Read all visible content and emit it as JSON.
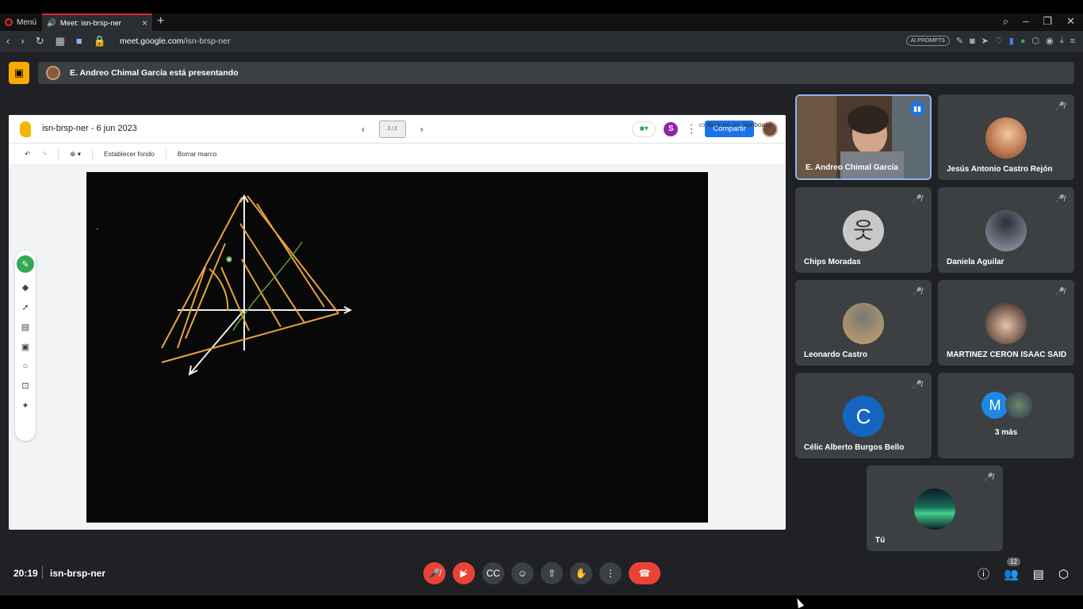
{
  "browser": {
    "menu_label": "Menú",
    "tab_title": "Meet: isn-brsp-ner",
    "url_domain": "meet.google.com",
    "url_path": "/isn-brsp-ner",
    "ai_prompts_label": "AI PROMPTS"
  },
  "meet": {
    "presenting_banner": "E. Andreo Chimal García está presentando",
    "time": "20:19",
    "meeting_code": "isn-brsp-ner",
    "participant_count": "12"
  },
  "jamboard": {
    "title": "isn-brsp-ner - 6 jun 2023",
    "frame_indicator": "2 / 2",
    "share_label": "Compartir",
    "set_background_label": "Establecer fondo",
    "clear_frame_label": "Borrar marco",
    "open_in_jamboard_label": "Abrir en un Jamboard",
    "colors": {
      "accent_blue": "#1a73e8",
      "pen_green": "#34a853",
      "drawing_orange": "#e8a33a"
    }
  },
  "participants": [
    {
      "name": "E. Andreo Chimal García",
      "active_speaker": true
    },
    {
      "name": "Jesús Antonio Castro Rejón",
      "muted": true
    },
    {
      "name": "Chips Moradas",
      "muted": true
    },
    {
      "name": "Daniela Aguilar",
      "muted": true
    },
    {
      "name": "Leonardo Castro",
      "muted": true
    },
    {
      "name": "MARTINEZ CERON ISAAC SAID",
      "muted": true
    },
    {
      "name": "Célic Alberto Burgos Bello",
      "muted": true,
      "initial": "C"
    },
    {
      "name": "3 más",
      "initial": "M"
    },
    {
      "name": "Tú",
      "muted": true
    }
  ]
}
